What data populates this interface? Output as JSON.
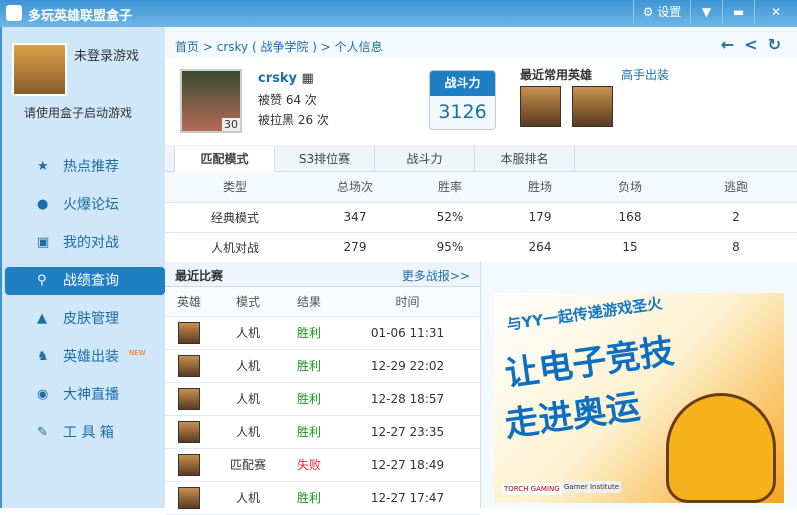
{
  "window": {
    "title": "多玩英雄联盟盒子",
    "settings": "设置"
  },
  "user": {
    "status": "未登录游戏",
    "hint": "请使用盒子启动游戏"
  },
  "nav": [
    {
      "label": "热点推荐",
      "icon": "★"
    },
    {
      "label": "火爆论坛",
      "icon": "●"
    },
    {
      "label": "我的对战",
      "icon": "▣"
    },
    {
      "label": "战绩查询",
      "icon": "⚲"
    },
    {
      "label": "皮肤管理",
      "icon": "▲"
    },
    {
      "label": "英雄出装",
      "icon": "♞",
      "badge": "NEW"
    },
    {
      "label": "大神直播",
      "icon": "◉"
    },
    {
      "label": "工 具 箱",
      "icon": "✎"
    }
  ],
  "breadcrumb": {
    "home": "首页",
    "player": "crsky ( 战争学院 )",
    "page": "个人信息",
    "sep": ">"
  },
  "profile": {
    "name": "crsky",
    "level": "30",
    "likes": "被赞 64 次",
    "blocked": "被拉黑 26 次",
    "power_label": "战斗力",
    "power": "3126",
    "recent_heroes": "最近常用英雄",
    "pro_builds": "高手出装"
  },
  "tabs": [
    "匹配模式",
    "S3排位赛",
    "战斗力",
    "本服排名"
  ],
  "stats": {
    "headers": [
      "类型",
      "总场次",
      "胜率",
      "胜场",
      "负场",
      "逃跑"
    ],
    "rows": [
      [
        "经典模式",
        "347",
        "52%",
        "179",
        "168",
        "2"
      ],
      [
        "人机对战",
        "279",
        "95%",
        "264",
        "15",
        "8"
      ]
    ]
  },
  "recent": {
    "title": "最近比赛",
    "more": "更多战报>>",
    "headers": [
      "英雄",
      "模式",
      "结果",
      "时间"
    ],
    "rows": [
      [
        "人机",
        "胜利",
        "01-06 11:31"
      ],
      [
        "人机",
        "胜利",
        "12-29 22:02"
      ],
      [
        "人机",
        "胜利",
        "12-28 18:57"
      ],
      [
        "人机",
        "胜利",
        "12-27 23:35"
      ],
      [
        "匹配赛",
        "失败",
        "12-27 18:49"
      ],
      [
        "人机",
        "胜利",
        "12-27 17:47"
      ]
    ]
  },
  "ad": {
    "line1": "与YY一起传递游戏圣火",
    "line2": "让电子竞技",
    "line3": "走进奥运",
    "logo1": "TORCH GAMING",
    "logo2": "Gamer Institute"
  }
}
